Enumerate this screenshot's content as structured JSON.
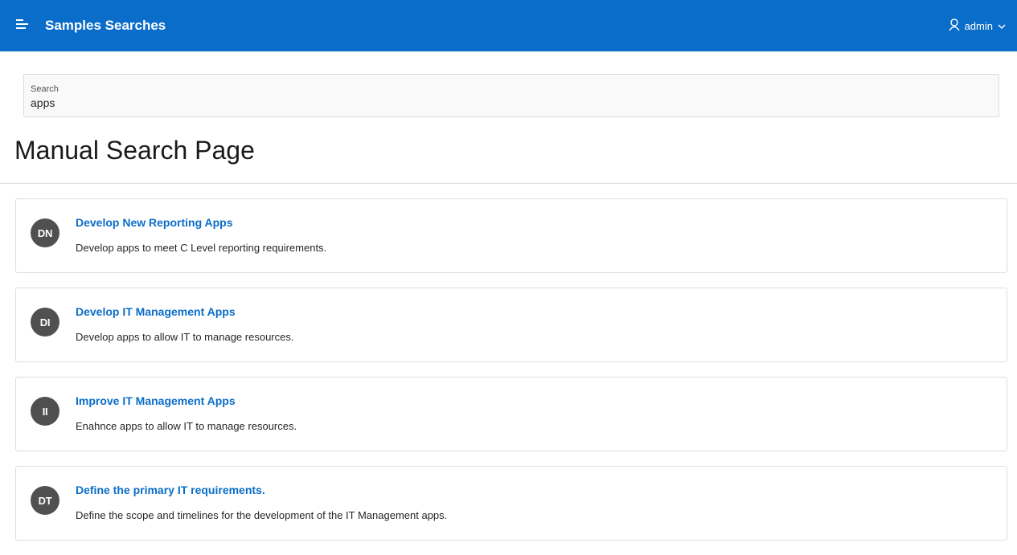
{
  "header": {
    "app_title": "Samples Searches",
    "user_name": "admin",
    "colors": {
      "bar": "#0a6dc9",
      "text": "#ffffff"
    }
  },
  "search": {
    "label": "Search",
    "value": "apps"
  },
  "page": {
    "title": "Manual Search Page"
  },
  "results": [
    {
      "initials": "DN",
      "title": "Develop New Reporting Apps",
      "description": "Develop apps to meet C Level reporting requirements."
    },
    {
      "initials": "DI",
      "title": "Develop IT Management Apps",
      "description": "Develop apps to allow IT to manage resources."
    },
    {
      "initials": "II",
      "title": "Improve IT Management Apps",
      "description": "Enahnce apps to allow IT to manage resources."
    },
    {
      "initials": "DT",
      "title": "Define the primary IT requirements.",
      "description": "Define the scope and timelines for the development of the IT Management apps."
    }
  ],
  "icons": {
    "menu": "hamburger-menu-icon",
    "user": "user-icon",
    "dropdown": "chevron-down-icon"
  }
}
